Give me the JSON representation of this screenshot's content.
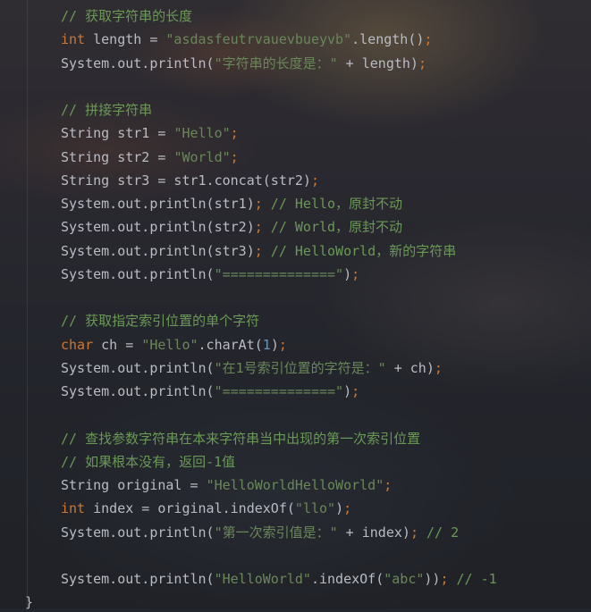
{
  "code_lines": [
    {
      "id": "l1",
      "segments": [
        [
          "c",
          "// 获取字符串的长度"
        ]
      ]
    },
    {
      "id": "l2",
      "segments": [
        [
          "k",
          "int"
        ],
        [
          "t",
          " length = "
        ],
        [
          "s",
          "\"asdasfeutrvauevbueyvb\""
        ],
        [
          "t",
          ".length()"
        ],
        [
          "k",
          ";"
        ]
      ]
    },
    {
      "id": "l3",
      "segments": [
        [
          "t",
          "System.out.println("
        ],
        [
          "s",
          "\"字符串的长度是：\""
        ],
        [
          "t",
          " + length)"
        ],
        [
          "k",
          ";"
        ]
      ]
    },
    {
      "id": "l4",
      "segments": [
        [
          "c",
          "// 拼接字符串"
        ]
      ]
    },
    {
      "id": "l5",
      "segments": [
        [
          "t",
          "String str1 = "
        ],
        [
          "s",
          "\"Hello\""
        ],
        [
          "k",
          ";"
        ]
      ]
    },
    {
      "id": "l6",
      "segments": [
        [
          "t",
          "String str2 = "
        ],
        [
          "s",
          "\"World\""
        ],
        [
          "k",
          ";"
        ]
      ]
    },
    {
      "id": "l7",
      "segments": [
        [
          "t",
          "String str3 = str1.concat(str2)"
        ],
        [
          "k",
          ";"
        ]
      ]
    },
    {
      "id": "l8",
      "segments": [
        [
          "t",
          "System.out.println(str1)"
        ],
        [
          "k",
          ";"
        ],
        [
          "c",
          " // Hello，原封不动"
        ]
      ]
    },
    {
      "id": "l9",
      "segments": [
        [
          "t",
          "System.out.println(str2)"
        ],
        [
          "k",
          ";"
        ],
        [
          "c",
          " // World，原封不动"
        ]
      ]
    },
    {
      "id": "l10",
      "segments": [
        [
          "t",
          "System.out.println(str3)"
        ],
        [
          "k",
          ";"
        ],
        [
          "c",
          " // HelloWorld，新的字符串"
        ]
      ]
    },
    {
      "id": "l11",
      "segments": [
        [
          "t",
          "System.out.println("
        ],
        [
          "s",
          "\"==============\""
        ],
        [
          "t",
          ")"
        ],
        [
          "k",
          ";"
        ]
      ]
    },
    {
      "id": "l12",
      "segments": [
        [
          "c",
          "// 获取指定索引位置的单个字符"
        ]
      ]
    },
    {
      "id": "l13",
      "segments": [
        [
          "k",
          "char"
        ],
        [
          "t",
          " ch = "
        ],
        [
          "s",
          "\"Hello\""
        ],
        [
          "t",
          ".charAt("
        ],
        [
          "n",
          "1"
        ],
        [
          "t",
          ")"
        ],
        [
          "k",
          ";"
        ]
      ]
    },
    {
      "id": "l14",
      "segments": [
        [
          "t",
          "System.out.println("
        ],
        [
          "s",
          "\"在1号索引位置的字符是：\""
        ],
        [
          "t",
          " + ch)"
        ],
        [
          "k",
          ";"
        ]
      ]
    },
    {
      "id": "l15",
      "segments": [
        [
          "t",
          "System.out.println("
        ],
        [
          "s",
          "\"==============\""
        ],
        [
          "t",
          ")"
        ],
        [
          "k",
          ";"
        ]
      ]
    },
    {
      "id": "l16",
      "segments": [
        [
          "c",
          "// 查找参数字符串在本来字符串当中出现的第一次索引位置"
        ]
      ]
    },
    {
      "id": "l17",
      "segments": [
        [
          "c",
          "// 如果根本没有，返回-1值"
        ]
      ]
    },
    {
      "id": "l18",
      "segments": [
        [
          "t",
          "String original = "
        ],
        [
          "s",
          "\"HelloWorldHelloWorld\""
        ],
        [
          "k",
          ";"
        ]
      ]
    },
    {
      "id": "l19",
      "segments": [
        [
          "k",
          "int"
        ],
        [
          "t",
          " index = original.indexOf("
        ],
        [
          "s",
          "\"llo\""
        ],
        [
          "t",
          ")"
        ],
        [
          "k",
          ";"
        ]
      ]
    },
    {
      "id": "l20",
      "segments": [
        [
          "t",
          "System.out.println("
        ],
        [
          "s",
          "\"第一次索引值是：\""
        ],
        [
          "t",
          " + index)"
        ],
        [
          "k",
          ";"
        ],
        [
          "c",
          " // 2"
        ]
      ]
    },
    {
      "id": "l21",
      "segments": [
        [
          "t",
          "System.out.println("
        ],
        [
          "s",
          "\"HelloWorld\""
        ],
        [
          "t",
          ".indexOf("
        ],
        [
          "s",
          "\"abc\""
        ],
        [
          "t",
          "))"
        ],
        [
          "k",
          ";"
        ],
        [
          "c",
          " // -1"
        ]
      ]
    },
    {
      "id": "l22",
      "segments": [
        [
          "t",
          "}"
        ]
      ]
    }
  ],
  "colors": {
    "comment": "#6a9955",
    "keyword": "#cc7832",
    "string": "#6a8759",
    "number": "#6897bb",
    "text": "#b9bcc4",
    "editor_background": "#24262d"
  }
}
